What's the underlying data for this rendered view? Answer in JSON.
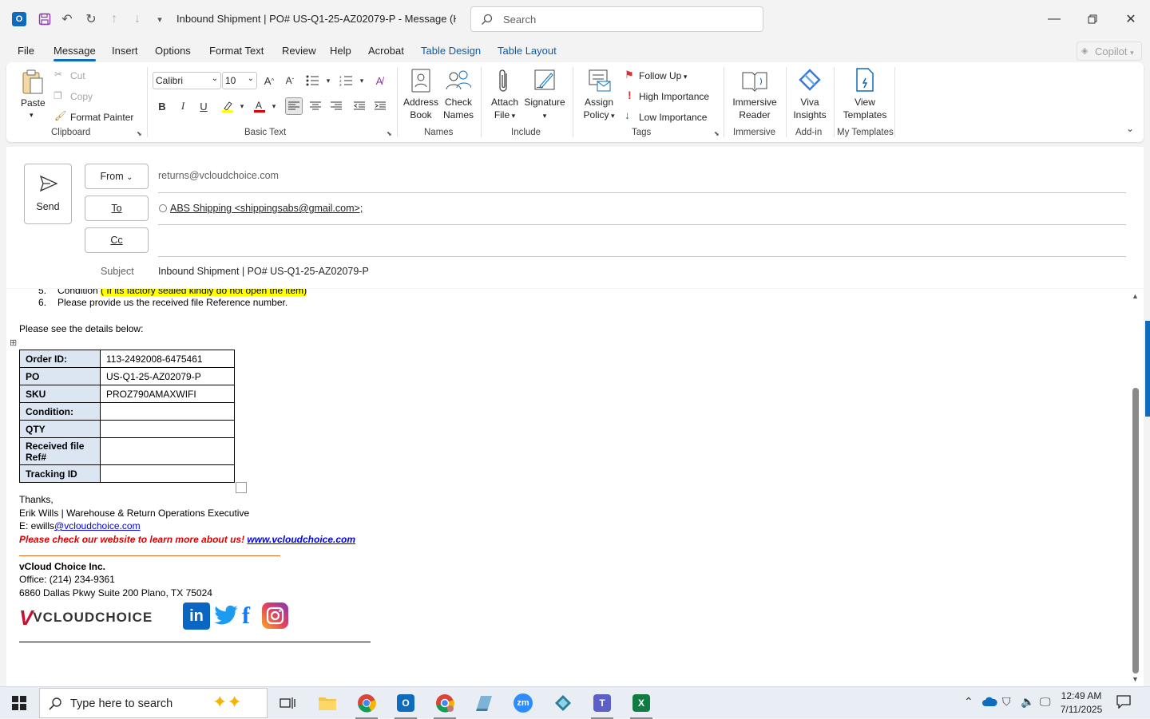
{
  "window": {
    "title": "Inbound Shipment | PO# US-Q1-25-AZ02079-P  -  Message (HT...",
    "search_placeholder": "Search"
  },
  "menu_tabs": [
    "File",
    "Message",
    "Insert",
    "Options",
    "Format Text",
    "Review",
    "Help",
    "Acrobat",
    "Table Design",
    "Table Layout"
  ],
  "copilot_label": "Copilot",
  "ribbon": {
    "clipboard": {
      "paste": "Paste",
      "cut": "Cut",
      "copy": "Copy",
      "format_painter": "Format Painter",
      "group": "Clipboard"
    },
    "basic_text": {
      "font": "Calibri",
      "size": "10",
      "group": "Basic Text",
      "bold": "B",
      "italic": "I",
      "underline": "U"
    },
    "names": {
      "address_book_1": "Address",
      "address_book_2": "Book",
      "check_names_1": "Check",
      "check_names_2": "Names",
      "group": "Names"
    },
    "include": {
      "attach_1": "Attach",
      "attach_2": "File",
      "signature": "Signature",
      "group": "Include"
    },
    "tags": {
      "assign_1": "Assign",
      "assign_2": "Policy",
      "follow_up": "Follow Up",
      "high": "High Importance",
      "low": "Low Importance",
      "group": "Tags"
    },
    "immersive": {
      "reader_1": "Immersive",
      "reader_2": "Reader",
      "group": "Immersive"
    },
    "addin": {
      "viva_1": "Viva",
      "viva_2": "Insights",
      "group": "Add-in"
    },
    "templates": {
      "view_1": "View",
      "view_2": "Templates",
      "group": "My Templates"
    }
  },
  "compose": {
    "send": "Send",
    "from_label": "From",
    "from_value": "returns@vcloudchoice.com",
    "to_label": "To",
    "to_value": "ABS Shipping <shippingsabs@gmail.com>;",
    "cc_label": "Cc",
    "subject_label": "Subject",
    "subject_value": "Inbound Shipment | PO# US-Q1-25-AZ02079-P"
  },
  "body": {
    "list": [
      {
        "num": "5.",
        "text": "Condition ",
        "highlight": "( If its factory sealed kindly do not open the item)"
      },
      {
        "num": "6.",
        "text": "Please provide us the received file Reference number.",
        "highlight": ""
      }
    ],
    "intro": "Please see the details below:",
    "table": [
      {
        "key": "Order ID:",
        "value": "113-2492008-6475461"
      },
      {
        "key": "PO",
        "value": "US-Q1-25-AZ02079-P"
      },
      {
        "key": "SKU",
        "value": "PROZ790AMAXWIFI"
      },
      {
        "key": "Condition:",
        "value": ""
      },
      {
        "key": "QTY",
        "value": ""
      },
      {
        "key": "Received file Ref#",
        "value": ""
      },
      {
        "key": "Tracking ID",
        "value": ""
      }
    ],
    "thanks": "Thanks,",
    "signature_name": "Erik Wills | Warehouse & Return Operations Executive",
    "email_prefix": "E: ewills",
    "email_link": "@vcloudchoice.com",
    "website_text": "Please check our website to learn more about us! ",
    "website_link": "www.vcloudchoice.com",
    "company": "vCloud Choice Inc.",
    "office": "Office: (214) 234-9361",
    "address": "6860 Dallas Pkwy Suite 200 Plano, TX 75024",
    "logo_text": "VCLOUDCHOICE",
    "social": {
      "linkedin": "in",
      "facebook": "f"
    }
  },
  "taskbar": {
    "search_placeholder": "Type here to search",
    "time": "12:49 AM",
    "date": "7/11/2025",
    "zoom_label": "zm"
  },
  "colors": {
    "accent": "#0f6cbd",
    "table_header": "#dce6f2",
    "red_text": "#e00000",
    "link": "#0000ee",
    "highlight": "#ffff00"
  }
}
